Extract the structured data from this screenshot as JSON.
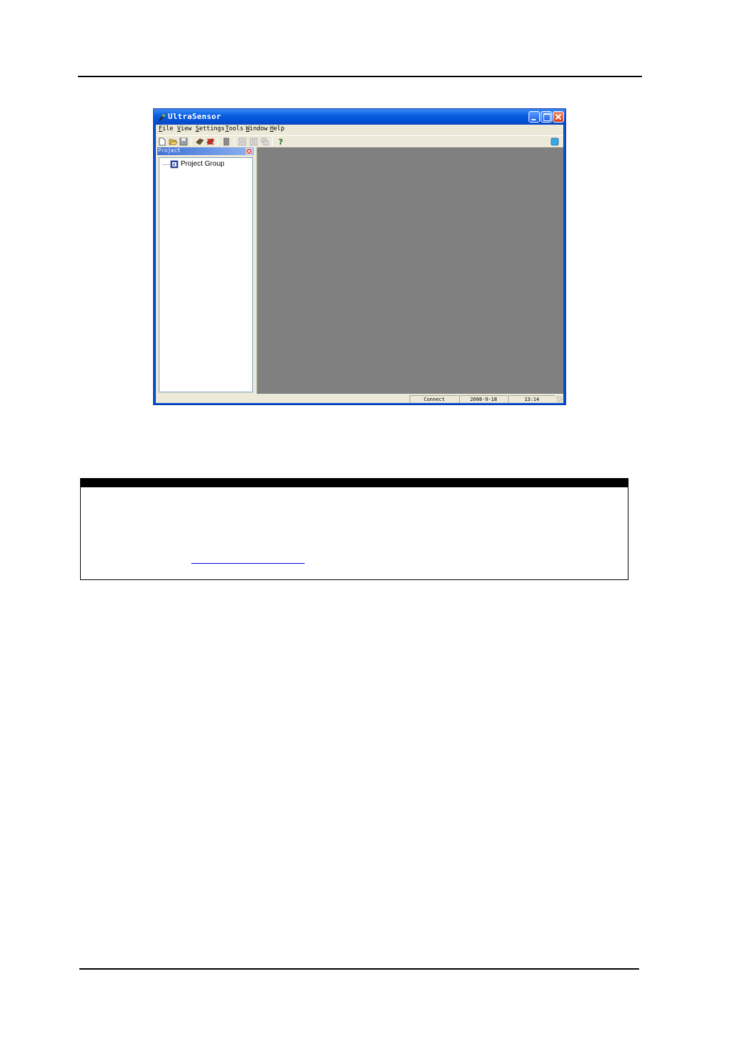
{
  "window": {
    "title": "UltraSensor",
    "controls": [
      "minimize",
      "maximize",
      "close"
    ]
  },
  "menu": [
    "File",
    "View",
    "Settings",
    "Tools",
    "Window",
    "Help"
  ],
  "toolbar": {
    "icons": [
      "new-file-icon",
      "open-folder-icon",
      "save-icon",
      "connect-icon",
      "disconnect-icon",
      "device-icon",
      "tile-horizontal-icon",
      "tile-vertical-icon",
      "cascade-icon",
      "help-icon",
      "status-indicator-icon"
    ]
  },
  "project_panel": {
    "caption": "Project",
    "tree": [
      {
        "label": "Project Group",
        "icon": "project-group-icon"
      }
    ]
  },
  "statusbar": {
    "connection": "Connect",
    "date": "2008-9-18",
    "time": "13:14"
  },
  "note": {
    "link_text": ""
  },
  "colors": {
    "titlebar": "#0a5fe0",
    "client_background": "#ece9d8",
    "mdi_background": "#808080"
  }
}
